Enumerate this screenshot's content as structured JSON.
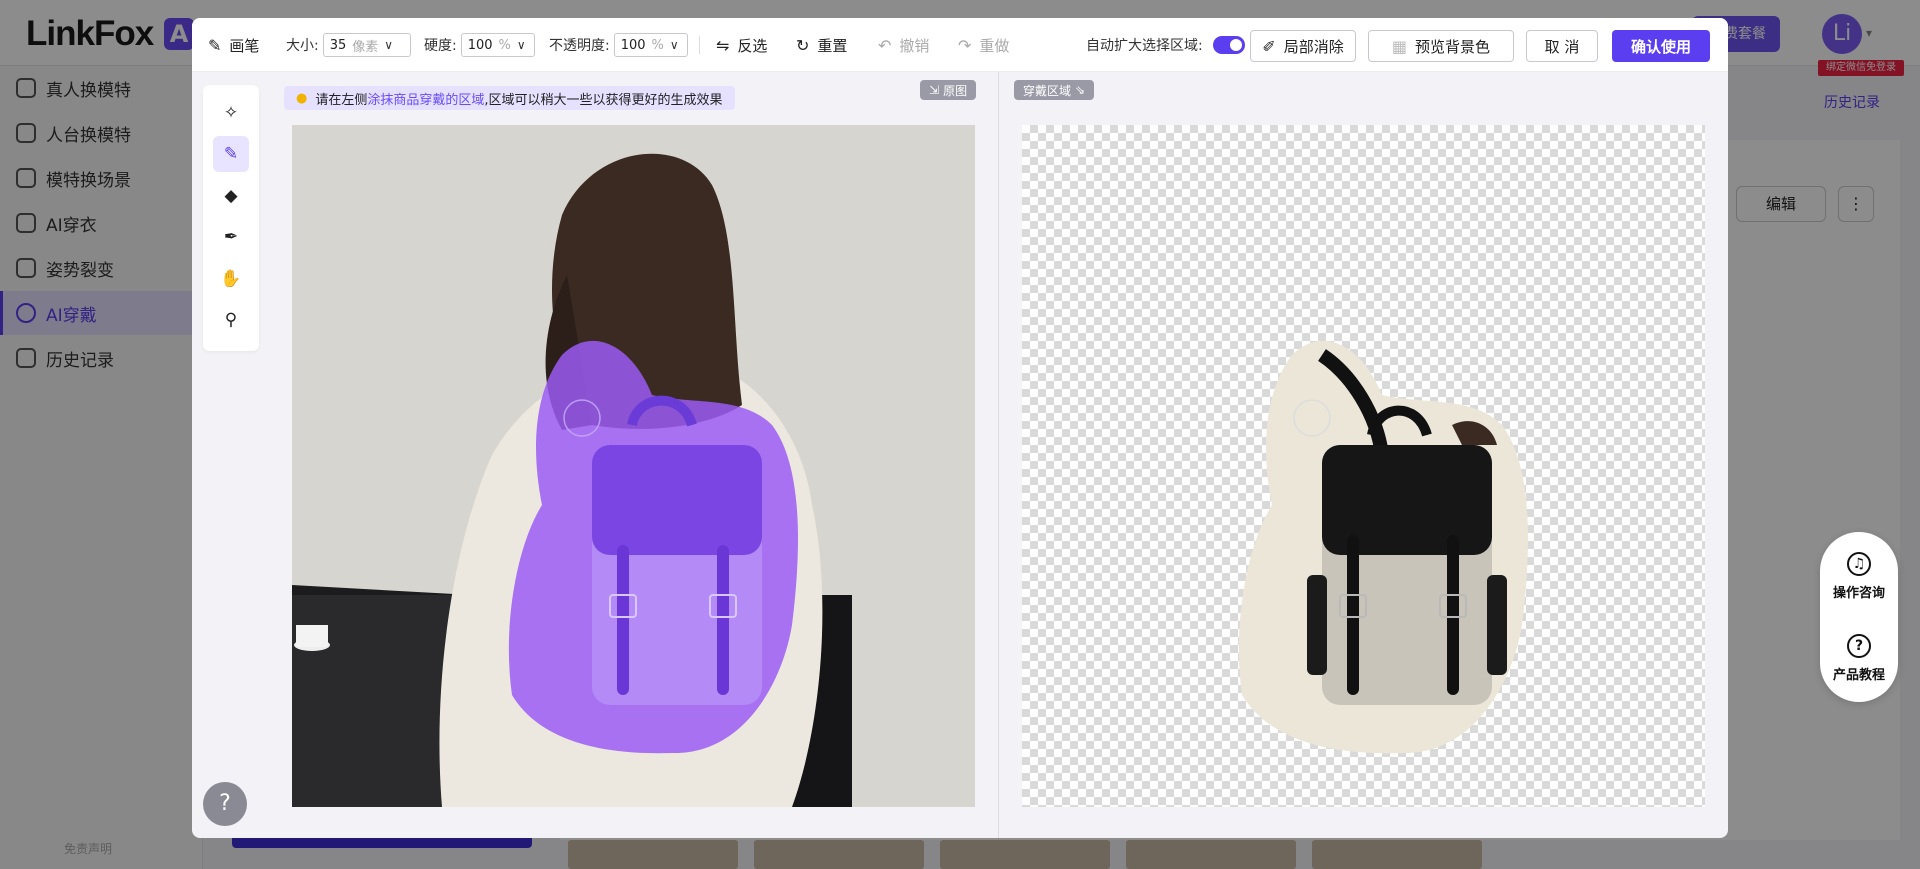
{
  "background_app": {
    "logo_text": "LinkFox",
    "logo_badge": "A",
    "buy_button": "费套餐",
    "avatar_letter": "Li",
    "wechat_tag": "绑定微信免登录",
    "history_link": "历史记录",
    "edit_button": "编辑",
    "more_button": "⋮",
    "disclaimer": "免责声明",
    "sidebar": [
      {
        "label": "真人换模特",
        "active": false
      },
      {
        "label": "人台换模特",
        "active": false
      },
      {
        "label": "模特换场景",
        "active": false
      },
      {
        "label": "AI穿衣",
        "active": false
      },
      {
        "label": "姿势裂变",
        "active": false
      },
      {
        "label": "AI穿戴",
        "active": true
      },
      {
        "label": "历史记录",
        "active": false
      }
    ],
    "float_help": {
      "consult_label": "操作咨询",
      "tutorial_label": "产品教程"
    }
  },
  "toolbar": {
    "tool_name": "画笔",
    "size_label": "大小:",
    "size_value": "35",
    "size_unit": "像素",
    "hardness_label": "硬度:",
    "hardness_value": "100",
    "hardness_unit": "%",
    "opacity_label": "不透明度:",
    "opacity_value": "100",
    "opacity_unit": "%",
    "invert_label": "反选",
    "reset_label": "重置",
    "undo_label": "撤销",
    "redo_label": "重做",
    "auto_expand_label": "自动扩大选择区域:",
    "auto_expand_on": true,
    "local_erase_label": "局部消除",
    "preview_bg_label": "预览背景色",
    "cancel_label": "取 消",
    "confirm_label": "确认使用"
  },
  "tools": [
    "magic-wand",
    "brush",
    "eraser",
    "pen",
    "hand",
    "zoom"
  ],
  "active_tool": "brush",
  "hint": {
    "prefix": "请在左侧",
    "emphasis": "涂抹商品穿戴的区域",
    "suffix": ",区域可以稍大一些以获得更好的生成效果"
  },
  "tags": {
    "original": "原图",
    "wear_area": "穿戴区域"
  },
  "colors": {
    "accent": "#5a3ef0",
    "mask": "#9b5cf5"
  },
  "help_button": "?"
}
